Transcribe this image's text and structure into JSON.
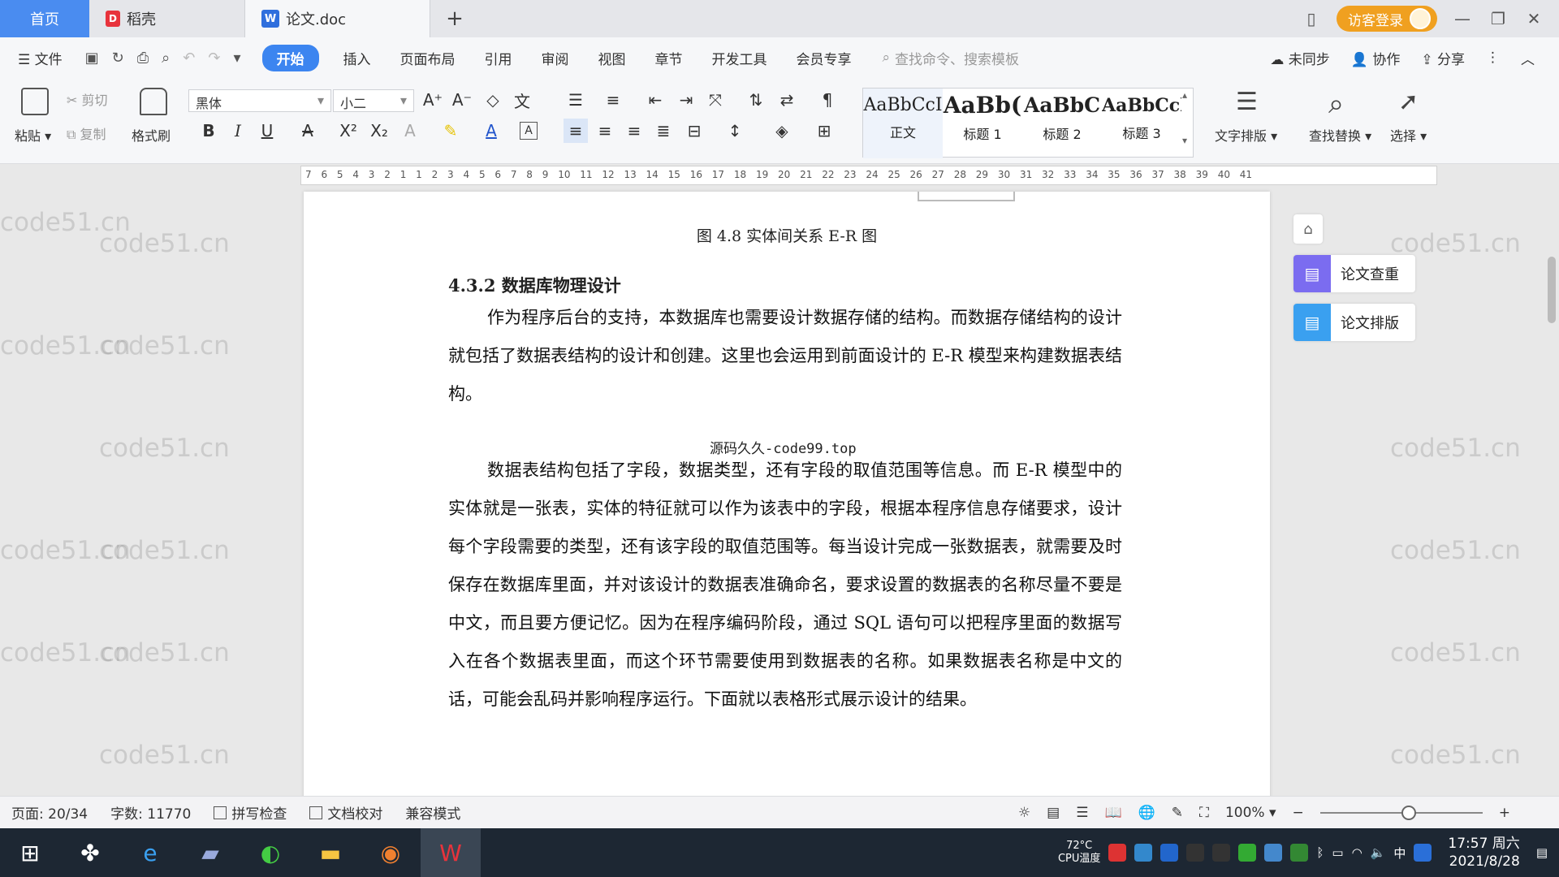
{
  "titlebar": {
    "home_tab": "首页",
    "tabs": [
      {
        "label": "稻壳"
      },
      {
        "label": "论文.doc"
      }
    ],
    "new_tab": "+",
    "login": "访客登录"
  },
  "menu": {
    "file": "文件",
    "items": [
      "开始",
      "插入",
      "页面布局",
      "引用",
      "审阅",
      "视图",
      "章节",
      "开发工具",
      "会员专享"
    ],
    "active": "开始",
    "search_placeholder": "查找命令、搜索模板",
    "sync": "未同步",
    "collab": "协作",
    "share": "分享"
  },
  "ribbon": {
    "paste": "粘贴",
    "cut": "剪切",
    "copy": "复制",
    "format_painter": "格式刷",
    "font_name": "黑体",
    "font_size": "小二",
    "styles": [
      {
        "preview": "AaBbCcI",
        "name": "正文"
      },
      {
        "preview": "AaBb(",
        "name": "标题 1"
      },
      {
        "preview": "AaBbC",
        "name": "标题 2"
      },
      {
        "preview": "AaBbCcl",
        "name": "标题 3"
      }
    ],
    "text_layout": "文字排版",
    "find_replace": "查找替换",
    "select": "选择"
  },
  "ruler": "7 6 5 4 3 2 1 1 2 3 4 5 6 7 8 9 10 11 12 13 14 15 16 17 18 19 20 21 22 23 24 25 26 27 28 29 30 31 32 33 34 35 36 37 38 39 40 41",
  "document": {
    "figure_caption": "图 4.8  实体间关系 E-R 图",
    "section_title": "4.3.2  数据库物理设计",
    "paragraph1": "作为程序后台的支持，本数据库也需要设计数据存储的结构。而数据存储结构的设计就包括了数据表结构的设计和创建。这里也会运用到前面设计的 E-R 模型来构建数据表结构。",
    "paragraph2": "数据表结构包括了字段，数据类型，还有字段的取值范围等信息。而 E-R 模型中的实体就是一张表，实体的特征就可以作为该表中的字段，根据本程序信息存储要求，设计每个字段需要的类型，还有该字段的取值范围等。每当设计完成一张数据表，就需要及时保存在数据库里面，并对该设计的数据表准确命名，要求设置的数据表的名称尽量不要是中文，而且要方便记忆。因为在程序编码阶段，通过 SQL 语句可以把程序里面的数据写入在各个数据表里面，而这个环节需要使用到数据表的名称。如果数据表名称是中文的话，可能会乱码并影响程序运行。下面就以表格形式展示设计的结果。",
    "overlay_watermark": "源码久久-code99.top",
    "bg_watermark": "code51.cn"
  },
  "side_panel": {
    "check": "论文查重",
    "format": "论文排版"
  },
  "status": {
    "page": "页面: 20/34",
    "words": "字数: 11770",
    "spell": "拼写检查",
    "proof": "文档校对",
    "compat": "兼容模式",
    "zoom": "100%"
  },
  "taskbar": {
    "temp": "72°C",
    "cpu": "CPU温度",
    "ime": "中",
    "time": "17:57 周六",
    "date": "2021/8/28"
  },
  "colors": {
    "accent": "#3c85f0",
    "login": "#f0a020",
    "side_check": "#7b6cf0",
    "side_format": "#3aa0f0"
  }
}
